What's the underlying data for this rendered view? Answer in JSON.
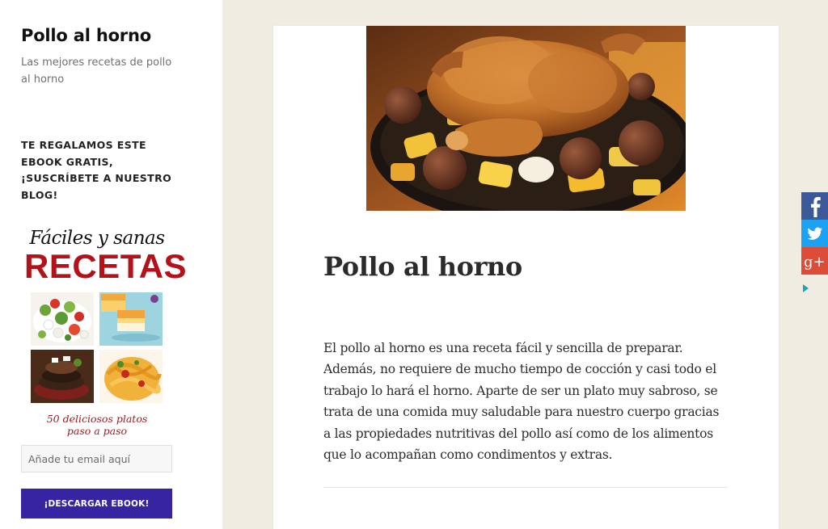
{
  "site": {
    "title": "Pollo al horno",
    "description": "Las mejores recetas de pollo al horno"
  },
  "sidebar": {
    "widget_title": "TE REGALAMOS ESTE EBOOK GRATIS, ¡SUSCRÍBETE A NUESTRO BLOG!",
    "ebook": {
      "script_title": "Fáciles y sanas",
      "big_title": "RECETAS",
      "subtitle_line1": "50 deliciosos platos",
      "subtitle_line2": "paso a paso"
    },
    "email_placeholder": "Añade tu email aquí",
    "download_label": "¡DESCARGAR EBOOK!"
  },
  "article": {
    "title": "Pollo al horno",
    "body": "El pollo al horno es una receta fácil y sencilla de preparar. Además, no requiere de mucho tiempo de cocción y casi todo el trabajo lo hará el horno. Aparte de ser un plato muy sabroso, se trata de una comida muy saludable para nuestro cuerpo gracias a las propiedades nutritivas del pollo así como de los alimentos que lo acompañan como condimentos y extras."
  },
  "share": {
    "items": [
      {
        "network": "facebook",
        "icon": "facebook-icon",
        "glyph": "f",
        "color": "#3b5998"
      },
      {
        "network": "twitter",
        "icon": "twitter-icon",
        "glyph": "",
        "color": "#1da1f2"
      },
      {
        "network": "google-plus",
        "icon": "google-plus-icon",
        "glyph": "g+",
        "color": "#dd4b39"
      }
    ],
    "toggle_icon": "chevron-right-icon"
  },
  "colors": {
    "background": "#f1ece2",
    "button": "#3624a3",
    "recetas_red": "#b4121b"
  }
}
